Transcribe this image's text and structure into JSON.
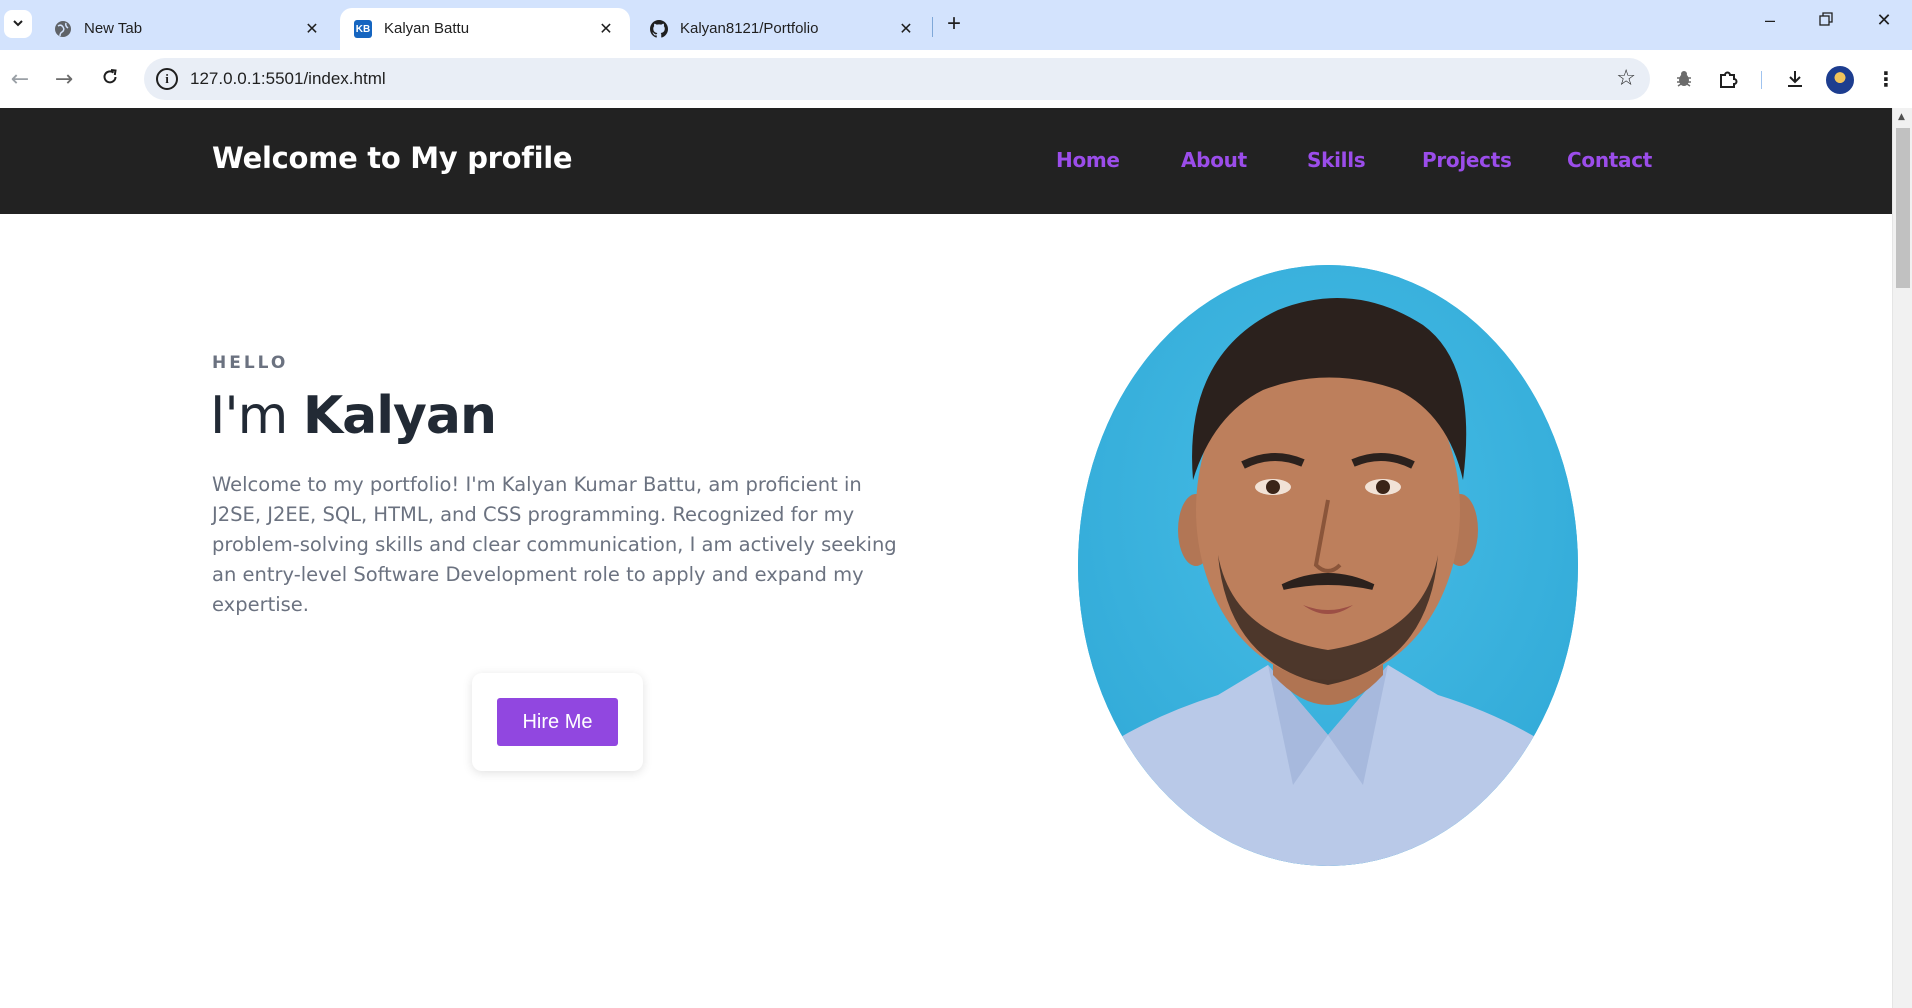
{
  "browser": {
    "tabs": [
      {
        "title": "New Tab",
        "icon": "globe-icon",
        "active": false
      },
      {
        "title": "Kalyan Battu",
        "icon": "kb-logo-icon",
        "favicon_text": "KB",
        "active": true
      },
      {
        "title": "Kalyan8121/Portfolio",
        "icon": "github-icon",
        "active": false
      }
    ],
    "url": "127.0.0.1:5501/index.html",
    "colors": {
      "tabstrip": "#d3e3fd",
      "omnibox": "#e9eef6"
    }
  },
  "site": {
    "brand": "Welcome to My profile",
    "nav": [
      "Home",
      "About",
      "Skills",
      "Projects",
      "Contact"
    ],
    "colors": {
      "header_bg": "#222222",
      "accent": "#9b4dea",
      "button": "#9147e0"
    }
  },
  "hero": {
    "kicker": "HELLO",
    "greeting_prefix": "I'm ",
    "name": "Kalyan",
    "intro": "Welcome to my portfolio! I'm Kalyan Kumar Battu, am proficient in J2SE, J2EE, SQL, HTML, and CSS programming. Recognized for my problem-solving skills and clear communication, I am actively seeking an entry-level Software Development role to apply and expand my expertise.",
    "cta": "Hire Me"
  }
}
